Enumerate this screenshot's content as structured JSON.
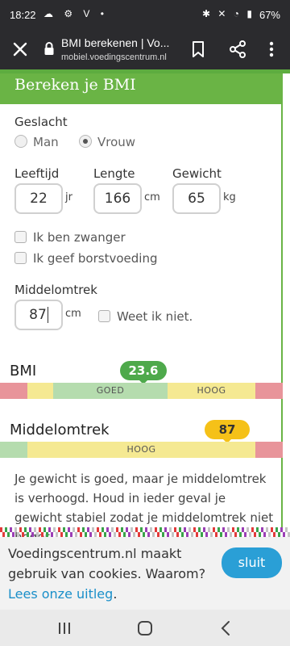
{
  "status_bar": {
    "time": "18:22",
    "left_icons": "☁ ⚙ V •",
    "right_icons": "✱ ✕ ◔ ▮",
    "battery": "67%"
  },
  "browser": {
    "title": "BMI berekenen | Vo...",
    "url": "mobiel.voedingscentrum.nl"
  },
  "page": {
    "header": "Bereken je BMI",
    "gender_label": "Geslacht",
    "gender_options": [
      "Man",
      "Vrouw"
    ],
    "gender_selected": "Vrouw",
    "age_label": "Leeftijd",
    "age_value": "22",
    "age_unit": "jr",
    "length_label": "Lengte",
    "length_value": "166",
    "length_unit": "cm",
    "weight_label": "Gewicht",
    "weight_value": "65",
    "weight_unit": "kg",
    "pregnant_label": "Ik ben zwanger",
    "breastfeeding_label": "Ik geef borstvoeding",
    "waist_label": "Middelomtrek",
    "waist_value": "87",
    "waist_unit": "cm",
    "waist_unknown_label": "Weet ik niet.",
    "bmi_title": "BMI",
    "bmi_value": "23.6",
    "bmi_segments": [
      "GOED",
      "HOOG"
    ],
    "waist_title": "Middelomtrek",
    "waist_result": "87",
    "waist_segment": "HOOG",
    "advice": "Je gewicht is goed, maar je middelomtrek is verhoogd. Houd in ieder geval je gewicht stabiel zodat je middelomtrek niet hoger"
  },
  "cookie": {
    "message": "Voedingscentrum.nl maakt gebruik van cookies. Waarom?",
    "link": "Lees onze uitleg",
    "link_suffix": ".",
    "button": "sluit"
  },
  "colors": {
    "green": "#6ab445",
    "bar_red": "#e8949a",
    "bar_yellow": "#f5e992",
    "bar_green": "#b5dcae",
    "pill_green": "#4ea94b",
    "pill_yellow": "#f5c118",
    "link_blue": "#1a8fc9"
  }
}
